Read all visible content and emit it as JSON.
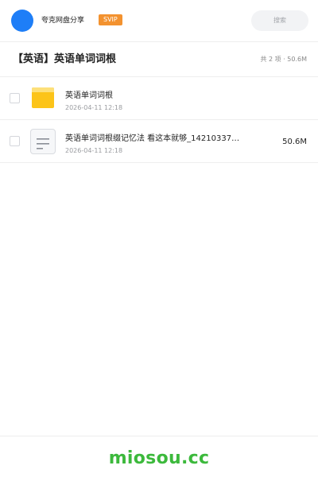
{
  "header": {
    "username": "夸克网盘分享",
    "badge": "SVIP",
    "search_placeholder": "搜索"
  },
  "folder": {
    "title": "【英语】英语单词词根",
    "summary": "共 2 项 · 50.6M"
  },
  "files": [
    {
      "name": "英语单词词根",
      "date": "2026-04-11 12:18",
      "size": "",
      "type": "folder",
      "icon": "folder-icon"
    },
    {
      "name": "英语单词词根缀记忆法 看这本就够_14210337…",
      "date": "2026-04-11 12:18",
      "size": "50.6M",
      "type": "document",
      "icon": "document-icon"
    }
  ],
  "footer": {
    "brand": "miosou.cc"
  },
  "colors": {
    "accent_blue": "#1e7ef7",
    "svip_orange": "#f3922f",
    "folder_yellow": "#fcc419",
    "brand_green": "#3cb93c"
  }
}
